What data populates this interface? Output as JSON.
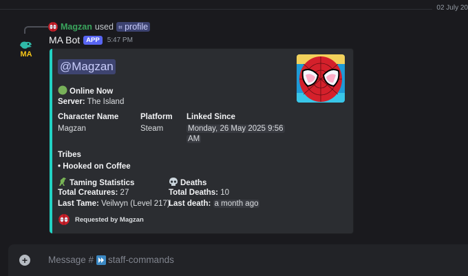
{
  "divider": {
    "date": "02 July 20"
  },
  "reply": {
    "username": "Magzan",
    "used": "used",
    "command": "profile"
  },
  "message": {
    "bot_name": "MA Bot",
    "tag": "APP",
    "time": "5:47 PM"
  },
  "embed": {
    "accent_color": "#22d3c4",
    "mention": "@Magzan",
    "status": "Online Now",
    "server_label": "Server:",
    "server_value": "The Island",
    "fields": {
      "character_name": {
        "name": "Character Name",
        "value": "Magzan"
      },
      "platform": {
        "name": "Platform",
        "value": "Steam"
      },
      "linked_since": {
        "name": "Linked Since",
        "value_line1": "Monday, 26 May 2025 9:56",
        "value_line2": "AM"
      }
    },
    "tribes": {
      "name": "Tribes",
      "value": "• Hooked on Coffee"
    },
    "taming": {
      "name": "Taming Statistics",
      "total_label": "Total Creatures:",
      "total_value": "27",
      "last_label": "Last Tame:",
      "last_value": "Veilwyn (Level 217)"
    },
    "deaths": {
      "name": "Deaths",
      "total_label": "Total Deaths:",
      "total_value": "10",
      "last_label": "Last death:",
      "last_value": "a month ago"
    },
    "footer": "Requested by Magzan"
  },
  "composer": {
    "placeholder_prefix": "Message #",
    "channel": "staff-commands"
  },
  "icons": {
    "status": "green-circle-icon",
    "taming": "dinosaur-icon",
    "deaths": "skull-icon",
    "channel": "fast-forward-icon",
    "add": "plus-circle-icon"
  }
}
